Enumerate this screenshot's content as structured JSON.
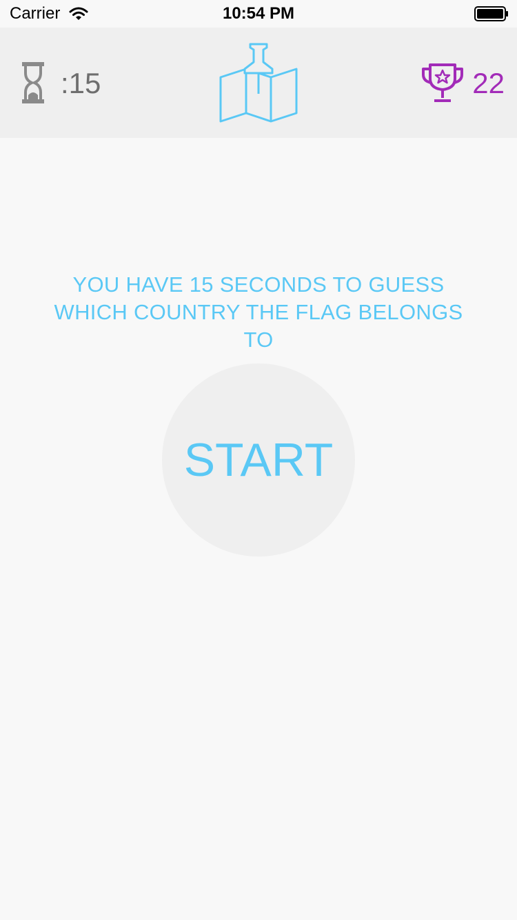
{
  "status_bar": {
    "carrier": "Carrier",
    "time": "10:54 PM",
    "wifi_icon": "wifi-icon",
    "battery_icon": "battery-icon"
  },
  "header": {
    "timer_icon": "hourglass-icon",
    "timer_value": ":15",
    "logo_icon": "map-pin-icon",
    "score_icon": "trophy-icon",
    "score_value": "22"
  },
  "main": {
    "instructions": "YOU HAVE 15 SECONDS TO GUESS WHICH COUNTRY THE FLAG BELONGS TO",
    "start_label": "START"
  },
  "colors": {
    "accent": "#5ac8f5",
    "score": "#a22bb8",
    "header_bg": "#efefef",
    "page_bg": "#f8f8f8",
    "timer_text": "#6e6e6e"
  }
}
